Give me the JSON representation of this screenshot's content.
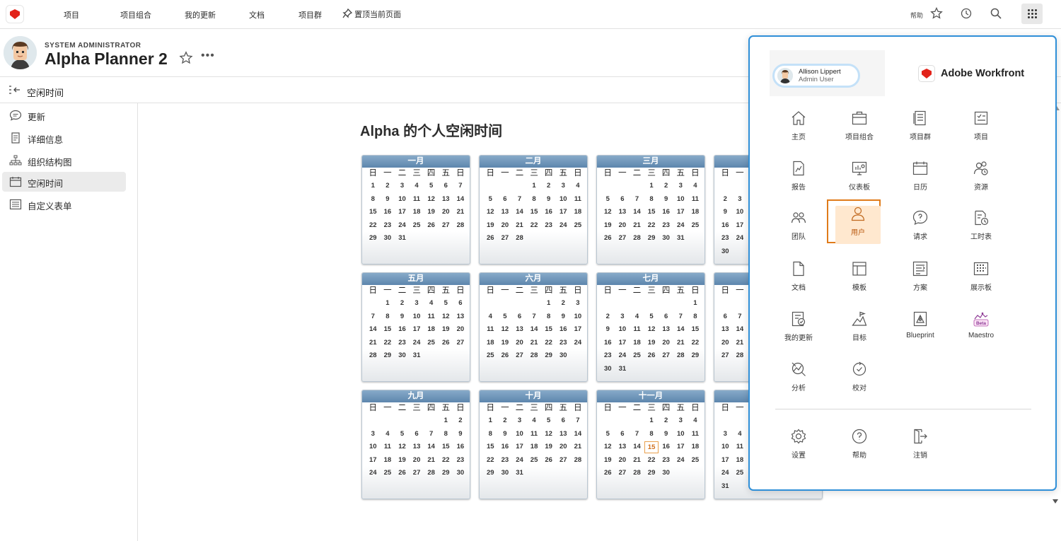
{
  "topnav": {
    "items": [
      "项目",
      "项目组合",
      "我的更新",
      "文档",
      "项目群"
    ],
    "pin_label": "置顶当前页面",
    "help_label": "帮助"
  },
  "header": {
    "role": "SYSTEM ADMINISTRATOR",
    "title": "Alpha Planner 2",
    "more": "•••"
  },
  "subheader": {
    "title": "空闲时间"
  },
  "sidebar": {
    "items": [
      {
        "label": "更新",
        "icon": "comment-icon"
      },
      {
        "label": "详细信息",
        "icon": "document-icon"
      },
      {
        "label": "组织结构图",
        "icon": "org-chart-icon"
      },
      {
        "label": "空闲时间",
        "icon": "calendar-icon",
        "active": true
      },
      {
        "label": "自定义表单",
        "icon": "form-icon"
      }
    ]
  },
  "main": {
    "title": "Alpha 的个人空闲时间",
    "weekdays": [
      "日",
      "一",
      "二",
      "三",
      "四",
      "五",
      "日"
    ],
    "months": [
      {
        "name": "一月",
        "offset": 0,
        "days": 31
      },
      {
        "name": "二月",
        "offset": 3,
        "days": 28
      },
      {
        "name": "三月",
        "offset": 3,
        "days": 31
      },
      {
        "name": "",
        "offset": 6,
        "days": 30
      },
      {
        "name": "五月",
        "offset": 1,
        "days": 31
      },
      {
        "name": "六月",
        "offset": 4,
        "days": 30
      },
      {
        "name": "七月",
        "offset": 6,
        "days": 31
      },
      {
        "name": "",
        "offset": 2,
        "days": 31
      },
      {
        "name": "九月",
        "offset": 5,
        "days": 30
      },
      {
        "name": "十月",
        "offset": 0,
        "days": 31
      },
      {
        "name": "十一月",
        "offset": 3,
        "days": 30
      },
      {
        "name": "",
        "offset": 5,
        "days": 31
      }
    ],
    "today": {
      "month": 10,
      "day": 15
    }
  },
  "launcher": {
    "user_name": "Allison Lippert",
    "user_role": "Admin User",
    "brand": "Adobe Workfront",
    "tiles": [
      {
        "label": "主页",
        "icon": "home-icon"
      },
      {
        "label": "项目组合",
        "icon": "portfolio-icon"
      },
      {
        "label": "项目群",
        "icon": "program-icon"
      },
      {
        "label": "项目",
        "icon": "project-icon"
      },
      {
        "label": "报告",
        "icon": "report-icon"
      },
      {
        "label": "仪表板",
        "icon": "dashboard-icon"
      },
      {
        "label": "日历",
        "icon": "calendar-icon"
      },
      {
        "label": "资源",
        "icon": "resources-icon"
      },
      {
        "label": "团队",
        "icon": "teams-icon"
      },
      {
        "label": "用户",
        "icon": "user-icon",
        "selected": true
      },
      {
        "label": "请求",
        "icon": "request-icon"
      },
      {
        "label": "工时表",
        "icon": "timesheet-icon"
      },
      {
        "label": "文档",
        "icon": "documents-icon"
      },
      {
        "label": "模板",
        "icon": "templates-icon"
      },
      {
        "label": "方案",
        "icon": "scenario-icon"
      },
      {
        "label": "展示板",
        "icon": "boards-icon"
      },
      {
        "label": "我的更新",
        "icon": "my-updates-icon"
      },
      {
        "label": "目标",
        "icon": "goals-icon"
      },
      {
        "label": "Blueprint",
        "icon": "blueprint-icon"
      },
      {
        "label": "Maestro",
        "icon": "maestro-icon",
        "badge": "Beta"
      },
      {
        "label": "分析",
        "icon": "analytics-icon"
      },
      {
        "label": "校对",
        "icon": "proof-icon"
      }
    ],
    "bottom": [
      {
        "label": "设置",
        "icon": "settings-icon"
      },
      {
        "label": "帮助",
        "icon": "help-icon"
      },
      {
        "label": "注销",
        "icon": "logout-icon"
      }
    ]
  },
  "colors": {
    "accent": "#2f8fd8",
    "selected_border": "#e07b1a",
    "selected_bg": "#ffe8cf",
    "calendar_header": "#6f95bb",
    "today": "#e9a04d"
  }
}
